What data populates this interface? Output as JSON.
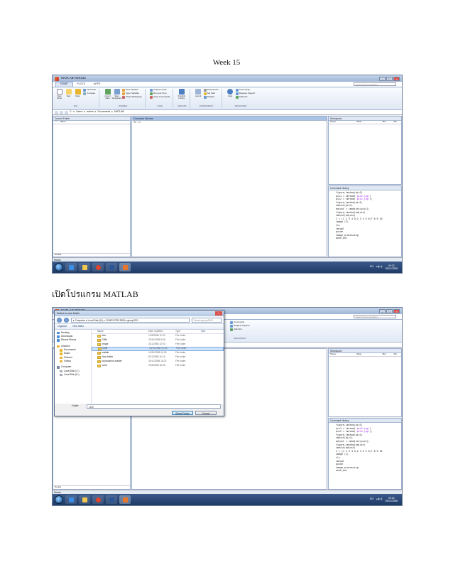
{
  "document": {
    "heading": "Week 15",
    "caption": "เปิดโปรแกรม MATLAB"
  },
  "matlab": {
    "window_title": "MATLAB R2013a",
    "tabs": [
      "HOME",
      "PLOTS",
      "APPS"
    ],
    "search_placeholder": "Search Documentation",
    "ribbon": {
      "new_script": "New Script",
      "new": "New",
      "open": "Open",
      "find_files": "Find Files",
      "compare": "Compare",
      "import_data": "Import Data",
      "save_workspace": "Save Workspace",
      "new_variable": "New Variable",
      "open_variable": "Open Variable",
      "clear_workspace": "Clear Workspace",
      "analyze_code": "Analyze Code",
      "run_and_time": "Run and Time",
      "clear_commands": "Clear Commands",
      "simulink_library": "Simulink Library",
      "layout": "Layout",
      "preferences": "Preferences",
      "set_path": "Set Path",
      "parallel": "Parallel",
      "help": "Help",
      "community": "Community",
      "request_support": "Request Support",
      "add_ons": "Add-Ons",
      "group_file": "FILE",
      "group_variable": "VARIABLE",
      "group_code": "CODE",
      "group_simulink": "SIMULINK",
      "group_environment": "ENVIRONMENT",
      "group_resources": "RESOURCES"
    },
    "path_segments": [
      "C:",
      "Users",
      "admin",
      "Documents",
      "MATLAB"
    ],
    "current_folder_title": "Current Folder",
    "name_col": "Name",
    "command_window_title": "Command Window",
    "prompt": "fx >>",
    "workspace_title": "Workspace",
    "workspace_cols": [
      "Name",
      "Value",
      "Min",
      "Ma"
    ],
    "history_title": "Command History",
    "history": [
      "figure,imshow(pic1)",
      "pic1 = imread('pic2.jpg')",
      "pic2 = imread('pic2.jpg');",
      "figure,imshow(pic1)",
      "imhist(pic1)",
      "adjust = imadjust(pic1);",
      "figure,imshow(adjust)",
      "imhist(adjust)",
      "C = [1 2 3 4 5;2 3 4 5 6;7 8 9 10",
      "image (C)",
      "clc",
      "imtool",
      "guide",
      "image_processing",
      "week_ant"
    ],
    "details": "Details",
    "status": "Ready",
    "tray_lang": "EN",
    "clock1": {
      "time": "09:23",
      "date": "25/01/2558"
    },
    "clock2": {
      "time": "09:24",
      "date": "25/01/2558"
    }
  },
  "dialog": {
    "title": "Select a new folder",
    "path": [
      "Computer",
      "Local Disk (D:)",
      "COMPUTER 2559",
      "group2201"
    ],
    "search_placeholder": "Search group2201",
    "organize": "Organize",
    "new_folder": "New folder",
    "nav": [
      "Desktop",
      "Downloads",
      "Recent Places",
      "Libraries",
      "Documents",
      "Music",
      "Pictures",
      "Videos",
      "Computer",
      "Local Disk (C:)",
      "Local Disk (D:)"
    ],
    "headers": [
      "Name",
      "Date modified",
      "Type",
      "Size"
    ],
    "files": [
      {
        "name": "ebe",
        "date": "19/8/2558 11:22",
        "type": "File folder"
      },
      {
        "name": "EBM",
        "date": "25/10/2558 9:36",
        "type": "File folder"
      },
      {
        "name": "image",
        "date": "4/11/2558 12:00",
        "type": "File folder"
      },
      {
        "name": "LDS",
        "date": "13/11/2558 10:16",
        "type": "File folder"
      },
      {
        "name": "matlab",
        "date": "18/10/2558 11:25",
        "type": "File folder"
      },
      {
        "name": "New folder",
        "date": "8/11/2558 10:16",
        "type": "File folder"
      },
      {
        "name": "topotoolbox-master",
        "date": "30/11/2558 18:22",
        "type": "File folder"
      },
      {
        "name": "work",
        "date": "26/8/2558 16:46",
        "type": "File folder"
      }
    ],
    "selected_index": 3,
    "folder_label": "Folder:",
    "folder_value": "LDS",
    "select_button": "Select Folder",
    "cancel_button": "Cancel"
  },
  "colors": {
    "accent": "#a9c2e6",
    "string": "#a020f0",
    "folder": "#f0c94a"
  }
}
